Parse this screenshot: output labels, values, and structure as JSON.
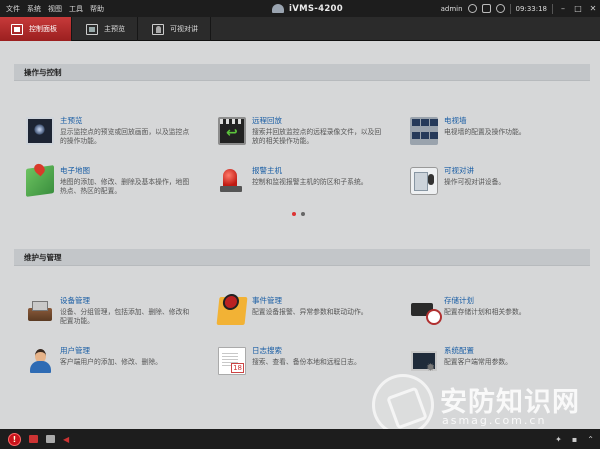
{
  "menu": [
    "文件",
    "系统",
    "视图",
    "工具",
    "帮助"
  ],
  "app_title": "iVMS-4200",
  "status": {
    "user": "admin",
    "time": "09:33:18"
  },
  "tabs": [
    {
      "label": "控制面板"
    },
    {
      "label": "主预览"
    },
    {
      "label": "可视对讲"
    }
  ],
  "sections": {
    "operation": {
      "title": "操作与控制",
      "items": [
        {
          "title": "主预览",
          "desc": "显示监控点的预览或回放画面，以及监控点的操作功能。"
        },
        {
          "title": "远程回放",
          "desc": "搜索并回放监控点的远程录像文件，以及回放的相关操作功能。"
        },
        {
          "title": "电视墙",
          "desc": "电视墙的配置及操作功能。"
        },
        {
          "title": "电子地图",
          "desc": "地图的添加、修改、删除及基本操作，地图热点、热区的配置。"
        },
        {
          "title": "报警主机",
          "desc": "控制和监视报警主机的防区和子系统。"
        },
        {
          "title": "可视对讲",
          "desc": "操作可视对讲设备。"
        }
      ]
    },
    "maintenance": {
      "title": "维护与管理",
      "items": [
        {
          "title": "设备管理",
          "desc": "设备、分组管理，包括添加、删除、修改和配置功能。"
        },
        {
          "title": "事件管理",
          "desc": "配置设备报警、异常参数和联动动作。"
        },
        {
          "title": "存储计划",
          "desc": "配置存储计划和相关参数。"
        },
        {
          "title": "用户管理",
          "desc": "客户端用户的添加、修改、删除。"
        },
        {
          "title": "日志搜索",
          "desc": "搜索、查看、备份本地和远程日志。"
        },
        {
          "title": "系统配置",
          "desc": "配置客户端常用参数。"
        }
      ]
    }
  },
  "watermark": {
    "text": "安防知识网",
    "url": "asmag.com.cn"
  }
}
